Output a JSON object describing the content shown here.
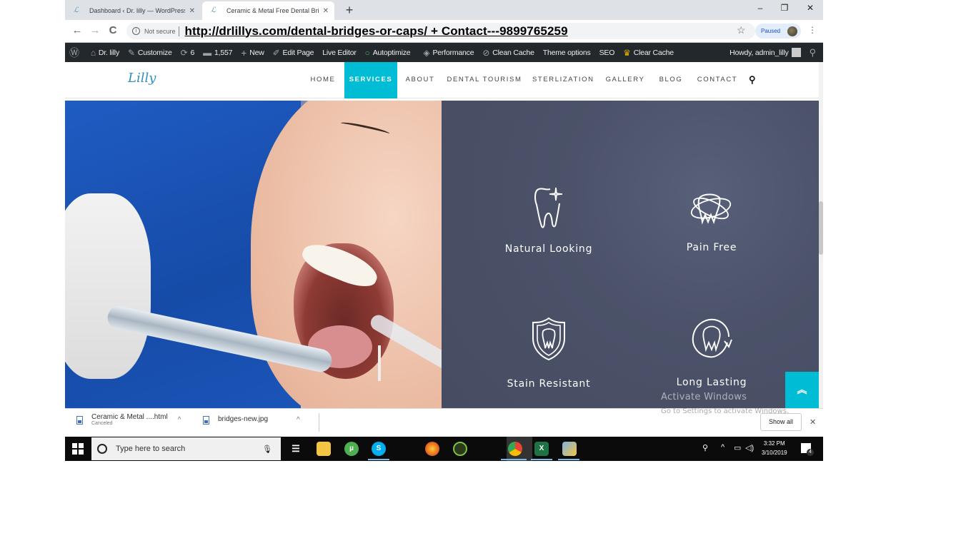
{
  "browser": {
    "tabs": [
      {
        "title": "Dashboard ‹ Dr. lilly — WordPress",
        "active": false
      },
      {
        "title": "Ceramic & Metal Free Dental Bri",
        "active": true
      }
    ],
    "new_tab_label": "+",
    "window_controls": {
      "minimize": "–",
      "maximize": "❐",
      "close": "✕"
    },
    "nav": {
      "back": "←",
      "forward": "→",
      "reload": "C"
    },
    "security_label": "Not secure",
    "url": "http://drlillys.com/dental-bridges-or-caps/  + Contact---9899765259",
    "profile_name": "Paused",
    "star_icon": "☆",
    "menu_icon": "⋮"
  },
  "admin_bar": {
    "items": [
      {
        "icon": "wordpress-icon",
        "glyph": "Ⓦ",
        "label": ""
      },
      {
        "icon": "site-icon",
        "glyph": "⌂",
        "label": "Dr. lilly"
      },
      {
        "icon": "brush-icon",
        "glyph": "✎",
        "label": "Customize"
      },
      {
        "icon": "updates-icon",
        "glyph": "⟳",
        "label": "6"
      },
      {
        "icon": "comments-icon",
        "glyph": "▬",
        "label": "1,557"
      },
      {
        "icon": "plus-icon",
        "glyph": "+",
        "label": "New"
      },
      {
        "icon": "pencil-icon",
        "glyph": "✐",
        "label": "Edit Page"
      },
      {
        "icon": "",
        "glyph": "",
        "label": "Live Editor"
      },
      {
        "icon": "autoptimize-icon",
        "glyph": "○",
        "label": "Autoptimize"
      },
      {
        "icon": "performance-icon",
        "glyph": "◈",
        "label": "Performance"
      },
      {
        "icon": "clean-cache-icon",
        "glyph": "⊘",
        "label": "Clean Cache"
      },
      {
        "icon": "",
        "glyph": "",
        "label": "Theme options"
      },
      {
        "icon": "",
        "glyph": "",
        "label": "SEO"
      },
      {
        "icon": "clear-cache-icon",
        "glyph": "♛",
        "label": "Clear Cache"
      }
    ],
    "greeting": "Howdy, admin_lilly",
    "search_glyph": "⚲"
  },
  "site": {
    "logo_text": "Lilly",
    "nav": [
      {
        "label": "HOME",
        "active": false
      },
      {
        "label": "SERVICES",
        "active": true
      },
      {
        "label": "ABOUT",
        "active": false
      },
      {
        "label": "DENTAL TOURISM",
        "active": false
      },
      {
        "label": "STERLIZATION",
        "active": false
      },
      {
        "label": "GALLERY",
        "active": false
      },
      {
        "label": "BLOG",
        "active": false
      },
      {
        "label": "CONTACT",
        "active": false
      }
    ],
    "search_glyph": "⚲",
    "accent_color": "#00bcd4",
    "features_bg": "#4b5269",
    "features": [
      {
        "label": "Natural Looking",
        "icon": "sparkling-tooth-icon"
      },
      {
        "label": "Pain Free",
        "icon": "tooth-orbit-icon"
      },
      {
        "label": "Stain Resistant",
        "icon": "shield-tooth-icon"
      },
      {
        "label": "Long Lasting",
        "icon": "cycle-tooth-icon"
      }
    ],
    "scroll_top_glyph": "︽"
  },
  "watermark": {
    "line1": "Activate Windows",
    "line2": "Go to Settings to activate Windows."
  },
  "downloads": {
    "items": [
      {
        "name": "Ceramic & Metal ....html",
        "status": "Canceled"
      },
      {
        "name": "bridges-new.jpg",
        "status": ""
      }
    ],
    "show_all_label": "Show all",
    "close_glyph": "✕"
  },
  "taskbar": {
    "search_placeholder": "Type here to search",
    "clock_time": "3:32 PM",
    "clock_date": "3/10/2019",
    "notification_count": "4"
  }
}
